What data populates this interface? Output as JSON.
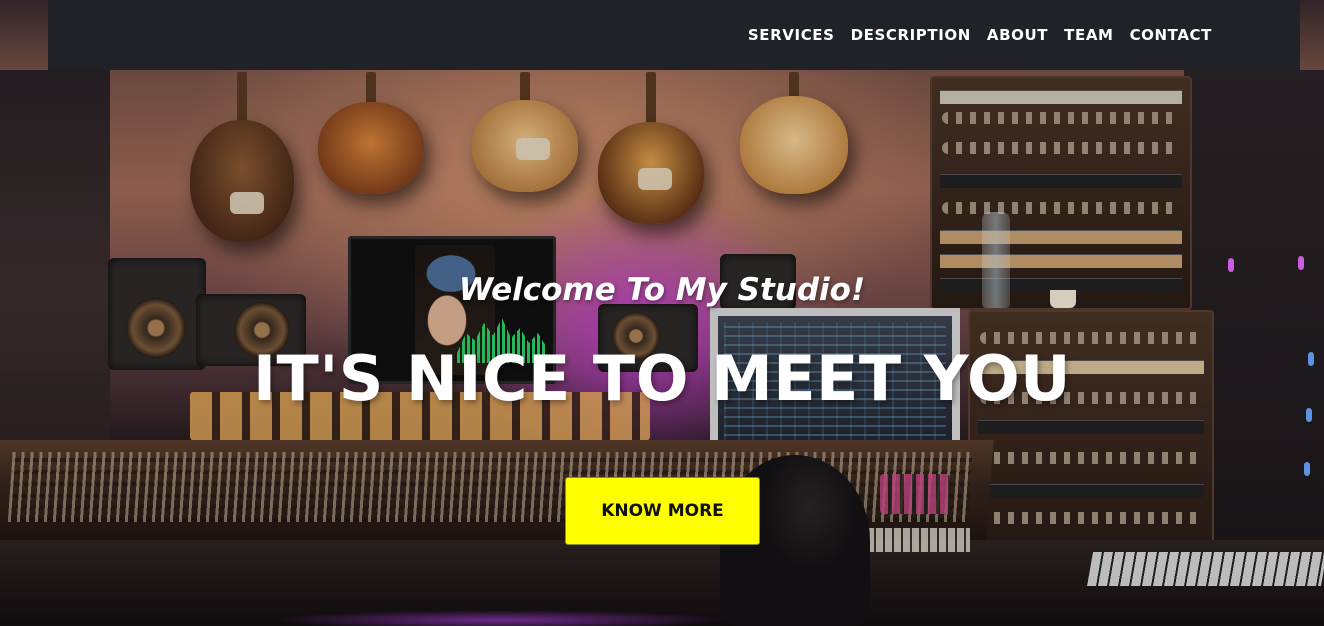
{
  "nav": {
    "links": [
      {
        "label": "SERVICES"
      },
      {
        "label": "DESCRIPTION"
      },
      {
        "label": "ABOUT"
      },
      {
        "label": "TEAM"
      },
      {
        "label": "CONTACT"
      }
    ]
  },
  "hero": {
    "subheading": "Welcome To My Studio!",
    "heading": "IT'S NICE TO MEET YOU",
    "cta_label": "KNOW MORE"
  },
  "colors": {
    "nav_background": "#202227",
    "cta_background": "#ffff00",
    "text": "#ffffff"
  },
  "icons": {
    "background_image": "music-studio-photo"
  }
}
